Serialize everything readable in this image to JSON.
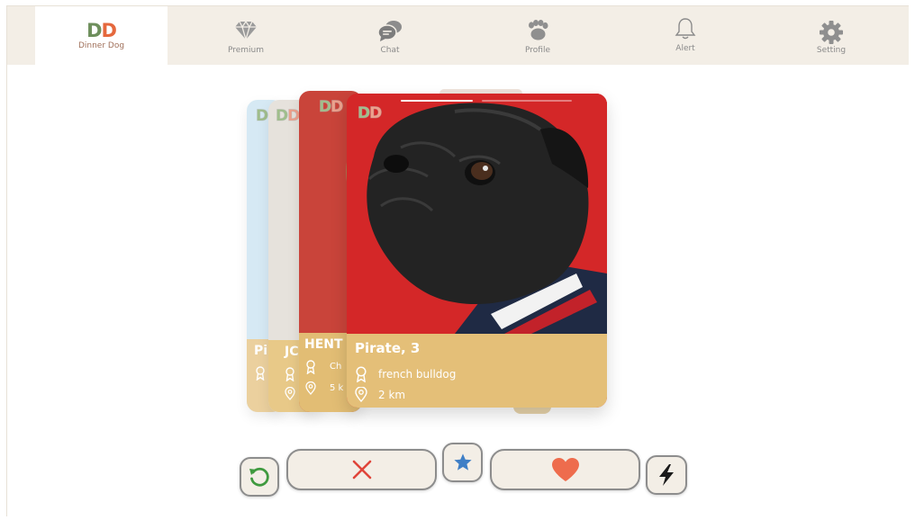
{
  "nav": {
    "logo": {
      "mark_first": "D",
      "mark_second": "D",
      "subtitle": "Dinner Dog"
    },
    "items": [
      {
        "label": "Premium",
        "icon": "diamond-icon"
      },
      {
        "label": "Chat",
        "icon": "chat-bubbles-icon"
      },
      {
        "label": "Profile",
        "icon": "paw-icon"
      },
      {
        "label": "Alert",
        "icon": "bell-icon"
      },
      {
        "label": "Setting",
        "icon": "gear-icon"
      }
    ]
  },
  "cards": {
    "main": {
      "name": "Pirate, 3",
      "breed": "french bulldog",
      "distance": "2 km",
      "logo_first": "D",
      "logo_second": "D"
    },
    "back2": {
      "name_partial": "HENT",
      "sub_partial": "Ch",
      "dist_partial": "5 k"
    },
    "back3": {
      "name_partial": "JC"
    },
    "back4": {
      "name_partial": "Pir"
    }
  },
  "actions": [
    {
      "name": "rewind",
      "icon": "rewind-icon"
    },
    {
      "name": "nope",
      "icon": "close-icon"
    },
    {
      "name": "super-like",
      "icon": "star-icon"
    },
    {
      "name": "like",
      "icon": "heart-icon"
    },
    {
      "name": "boost",
      "icon": "lightning-icon"
    }
  ],
  "colors": {
    "nav_bg": "#f3eee6",
    "card_info": "#e4bf78",
    "card_red": "#d92a2a",
    "brand_green": "#6e8f5c",
    "brand_orange": "#e5683d",
    "nope_red": "#e0453a",
    "like_orange": "#ee6c4d",
    "star_blue": "#3f7fc6",
    "rewind_green": "#3f9a3f"
  }
}
